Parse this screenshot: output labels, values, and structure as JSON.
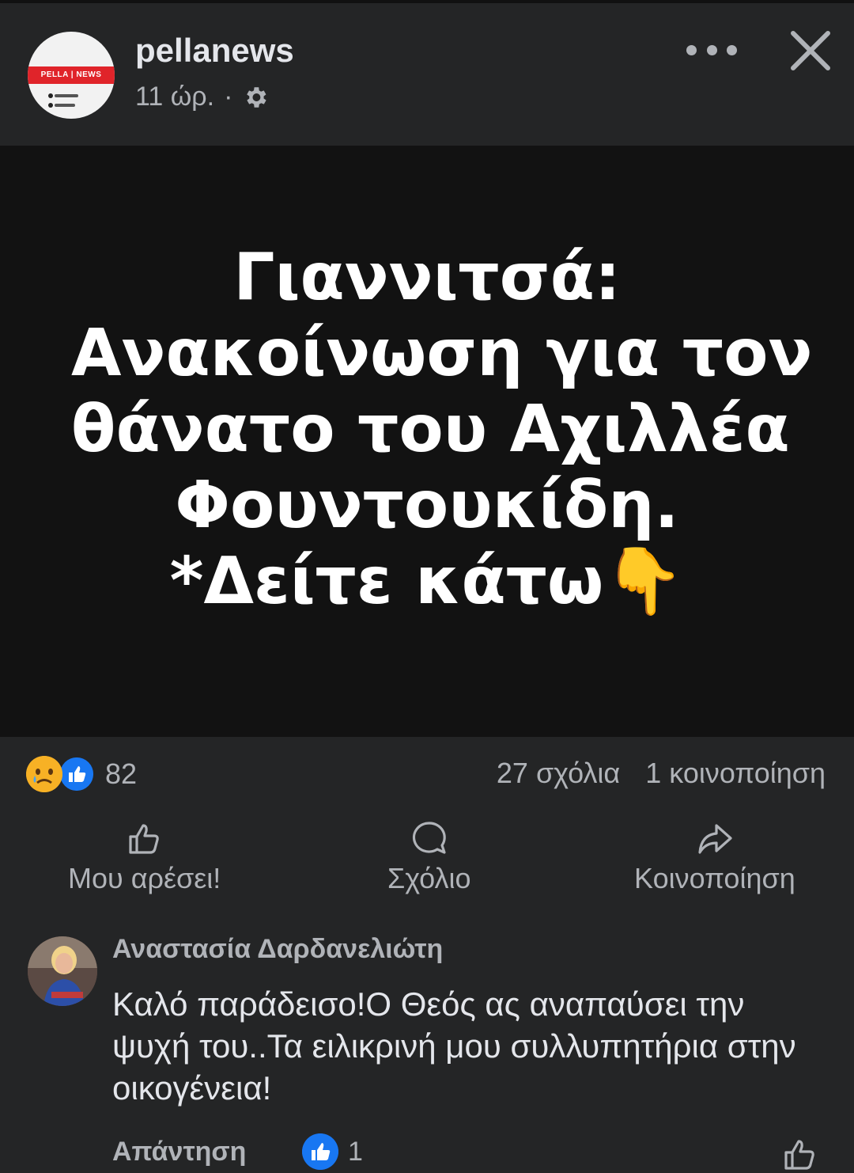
{
  "header": {
    "page_name": "pellanews",
    "time": "11 ώρ.",
    "separator": "·",
    "avatar_text": "PELLA | NEWS"
  },
  "post": {
    "headline_lines": [
      "Γιαννιτσά:",
      "Ανακοίνωση για τον",
      "θάνατο του Αχιλλέα",
      "Φουντουκίδη.",
      "*Δείτε κάτω👇"
    ]
  },
  "reactions": {
    "count": "82",
    "icons": [
      "sad-reaction-icon",
      "like-reaction-icon"
    ],
    "comments": "27 σχόλια",
    "shares": "1 κοινοποίηση"
  },
  "actions": {
    "like": "Μου αρέσει!",
    "comment": "Σχόλιο",
    "share": "Κοινοποίηση"
  },
  "comment": {
    "author": "Αναστασία Δαρδανελιώτη",
    "text": "Καλό παράδεισο!Ο Θεός ας αναπαύσει την ψυχή του..Τα ειλικρινή μου συλλυπητήρια στην οικογένεια!",
    "reply_label": "Απάντηση",
    "like_count": "1"
  },
  "colors": {
    "background": "#242526",
    "image_background": "#121212",
    "text": "#e4e6eb",
    "secondary": "#b0b3b8",
    "like_blue": "#1877f2",
    "sad_yellow": "#f7b125"
  }
}
